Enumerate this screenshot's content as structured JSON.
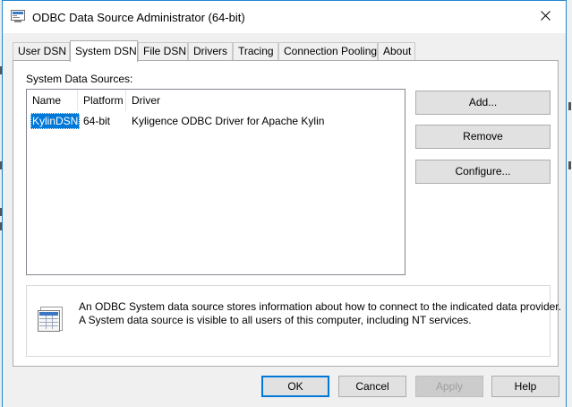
{
  "window": {
    "title": "ODBC Data Source Administrator (64-bit)",
    "accent_color": "#1f86d1",
    "icon": "odbc-admin-icon"
  },
  "tabs": [
    {
      "label": "User DSN",
      "active": false
    },
    {
      "label": "System DSN",
      "active": true
    },
    {
      "label": "File DSN",
      "active": false
    },
    {
      "label": "Drivers",
      "active": false
    },
    {
      "label": "Tracing",
      "active": false
    },
    {
      "label": "Connection Pooling",
      "active": false
    },
    {
      "label": "About",
      "active": false
    }
  ],
  "panel": {
    "section_label": "System Data Sources:",
    "columns": [
      "Name",
      "Platform",
      "Driver"
    ],
    "rows": [
      {
        "name": "KylinDSN",
        "platform": "64-bit",
        "driver": "Kyligence ODBC Driver for Apache Kylin",
        "selected": true
      }
    ],
    "buttons": {
      "add": "Add...",
      "remove": "Remove",
      "configure": "Configure..."
    },
    "info": {
      "icon": "database-table-icon",
      "line1": "An ODBC System data source stores information about how to connect to the indicated data provider.",
      "line2": "A System data source is visible to all users of this computer, including NT services."
    }
  },
  "footer": {
    "ok": "OK",
    "cancel": "Cancel",
    "apply": "Apply",
    "help": "Help"
  },
  "selection_color": "#0078d7"
}
